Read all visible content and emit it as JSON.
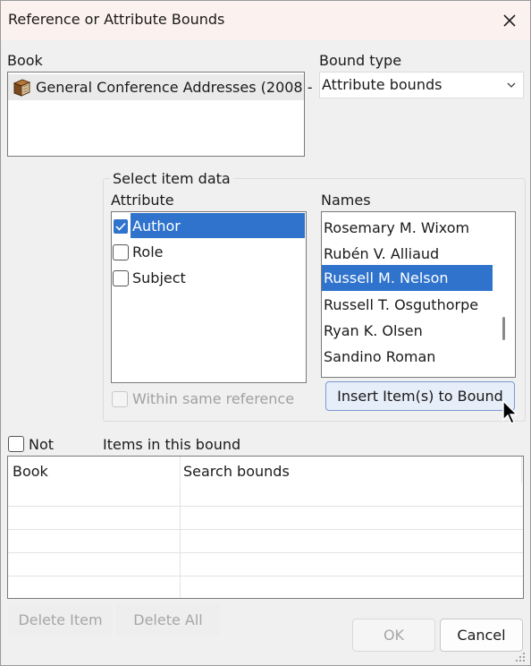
{
  "window": {
    "title": "Reference or Attribute Bounds",
    "close": "✕"
  },
  "book": {
    "label": "Book",
    "item": "General Conference Addresses (2008 -",
    "icon": "book-icon"
  },
  "bound_type": {
    "label": "Bound type",
    "value": "Attribute bounds"
  },
  "select_item_data": {
    "legend": "Select item data",
    "attribute_label": "Attribute",
    "attributes": [
      {
        "label": "Author",
        "checked": true,
        "selected": true
      },
      {
        "label": "Role",
        "checked": false,
        "selected": false
      },
      {
        "label": "Subject",
        "checked": false,
        "selected": false
      }
    ],
    "names_label": "Names",
    "names": [
      {
        "label": "Rosemary M. Wixom",
        "selected": false
      },
      {
        "label": "Rubén V. Alliaud",
        "selected": false
      },
      {
        "label": "Russell M. Nelson",
        "selected": true
      },
      {
        "label": "Russell T. Osguthorpe",
        "selected": false
      },
      {
        "label": "Ryan K. Olsen",
        "selected": false
      },
      {
        "label": "Sandino Roman",
        "selected": false
      }
    ],
    "within_same_reference": "Within same reference",
    "insert_button": "Insert Item(s) to Bound"
  },
  "not_label": "Not",
  "items_label": "Items in this bound",
  "items_table": {
    "columns": [
      "Book",
      "Search bounds"
    ]
  },
  "buttons": {
    "delete_item": "Delete Item",
    "delete_all": "Delete All",
    "ok": "OK",
    "cancel": "Cancel"
  }
}
